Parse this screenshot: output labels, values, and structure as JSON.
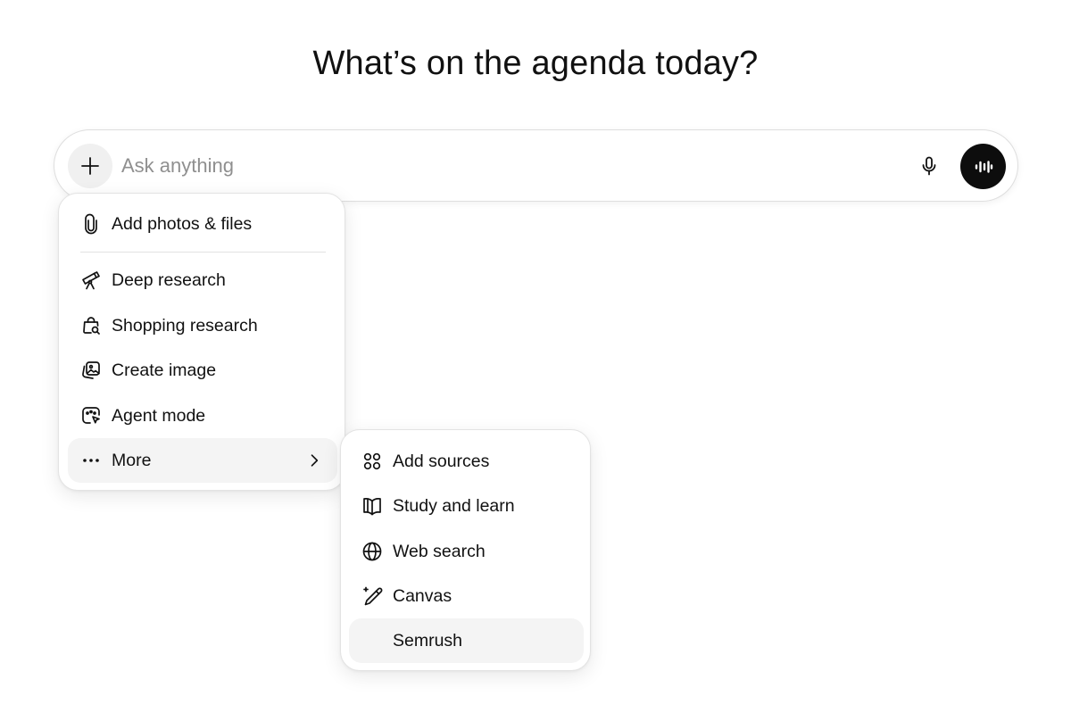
{
  "heading": "What’s on the agenda today?",
  "composer": {
    "placeholder": "Ask anything",
    "add_icon": "plus-icon",
    "mic_icon": "microphone-icon",
    "voice_icon": "voice-waveform-icon"
  },
  "menu": {
    "items": [
      {
        "label": "Add photos & files",
        "icon": "paperclip-icon"
      },
      {
        "label": "Deep research",
        "icon": "telescope-icon"
      },
      {
        "label": "Shopping research",
        "icon": "shopping-bag-search-icon"
      },
      {
        "label": "Create image",
        "icon": "image-icon"
      },
      {
        "label": "Agent mode",
        "icon": "agent-cursor-icon"
      },
      {
        "label": "More",
        "icon": "ellipsis-icon"
      }
    ]
  },
  "submenu": {
    "items": [
      {
        "label": "Add sources",
        "icon": "sources-icon"
      },
      {
        "label": "Study and learn",
        "icon": "open-book-icon"
      },
      {
        "label": "Web search",
        "icon": "globe-icon"
      },
      {
        "label": "Canvas",
        "icon": "pencil-sparkle-icon"
      },
      {
        "label": "Semrush",
        "icon": ""
      }
    ]
  }
}
